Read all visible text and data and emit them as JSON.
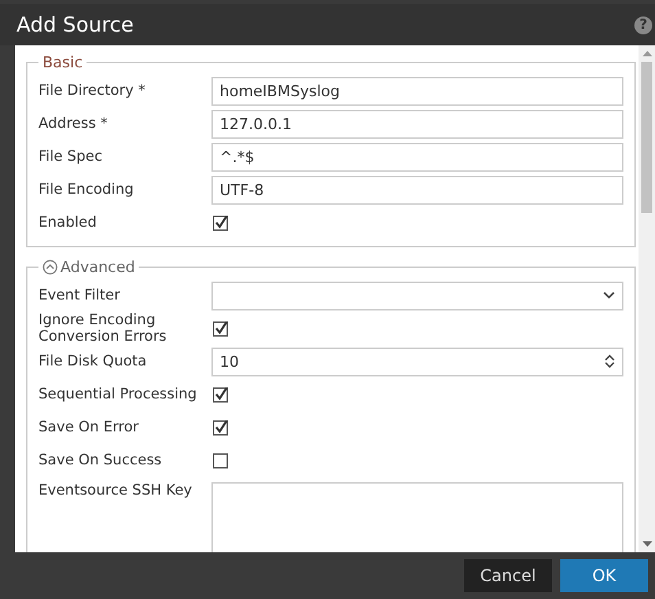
{
  "window": {
    "title": "Add Source",
    "help_icon": "?"
  },
  "sections": [
    {
      "legend": "Basic",
      "fields": [
        {
          "kind": "text",
          "label": "File Directory *",
          "value": "homeIBMSyslog"
        },
        {
          "kind": "text",
          "label": "Address *",
          "value": "127.0.0.1"
        },
        {
          "kind": "text",
          "label": "File Spec",
          "value": "^.*$"
        },
        {
          "kind": "text",
          "label": "File Encoding",
          "value": "UTF-8"
        },
        {
          "kind": "checkbox",
          "label": "Enabled",
          "checked": true
        }
      ]
    },
    {
      "legend": "Advanced",
      "collapsible": true,
      "expanded": true,
      "fields": [
        {
          "kind": "select",
          "label": "Event Filter"
        },
        {
          "kind": "checkbox",
          "label": "Ignore Encoding Conversion Errors",
          "checked": true
        },
        {
          "kind": "number",
          "label": "File Disk Quota",
          "value": "10"
        },
        {
          "kind": "checkbox",
          "label": "Sequential Processing",
          "checked": true
        },
        {
          "kind": "checkbox",
          "label": "Save On Error",
          "checked": true
        },
        {
          "kind": "checkbox",
          "label": "Save On Success",
          "checked": false
        },
        {
          "kind": "textarea",
          "label": "Eventsource SSH Key"
        }
      ]
    }
  ],
  "buttons": [
    {
      "label": "Cancel",
      "kind": "secondary"
    },
    {
      "label": "OK",
      "kind": "primary"
    }
  ]
}
